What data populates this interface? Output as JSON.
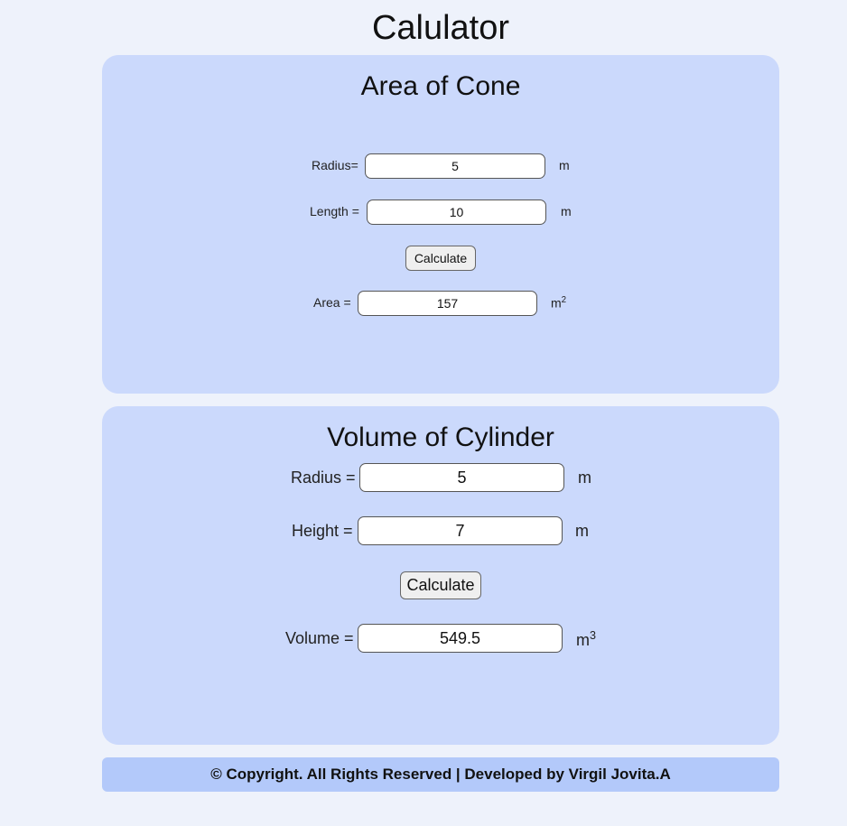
{
  "page": {
    "title": "Calulator"
  },
  "cone": {
    "title": "Area of Cone",
    "radius_label": "Radius=",
    "radius_value": "5",
    "radius_unit": "m",
    "length_label": "Length =",
    "length_value": "10",
    "length_unit": "m",
    "calculate_label": "Calculate",
    "area_label": "Area =",
    "area_value": "157",
    "area_unit": "m",
    "area_unit_exp": "2"
  },
  "cylinder": {
    "title": "Volume of Cylinder",
    "radius_label": "Radius =",
    "radius_value": "5",
    "radius_unit": "m",
    "height_label": "Height =",
    "height_value": "7",
    "height_unit": "m",
    "calculate_label": "Calculate",
    "volume_label": "Volume =",
    "volume_value": "549.5",
    "volume_unit": "m",
    "volume_unit_exp": "3"
  },
  "footer": {
    "text": "© Copyright. All Rights Reserved | Developed by Virgil Jovita.A"
  },
  "colors": {
    "page_background": "#eef2fb",
    "card_background": "#cbd9fc",
    "footer_background": "#b3c9fa"
  }
}
